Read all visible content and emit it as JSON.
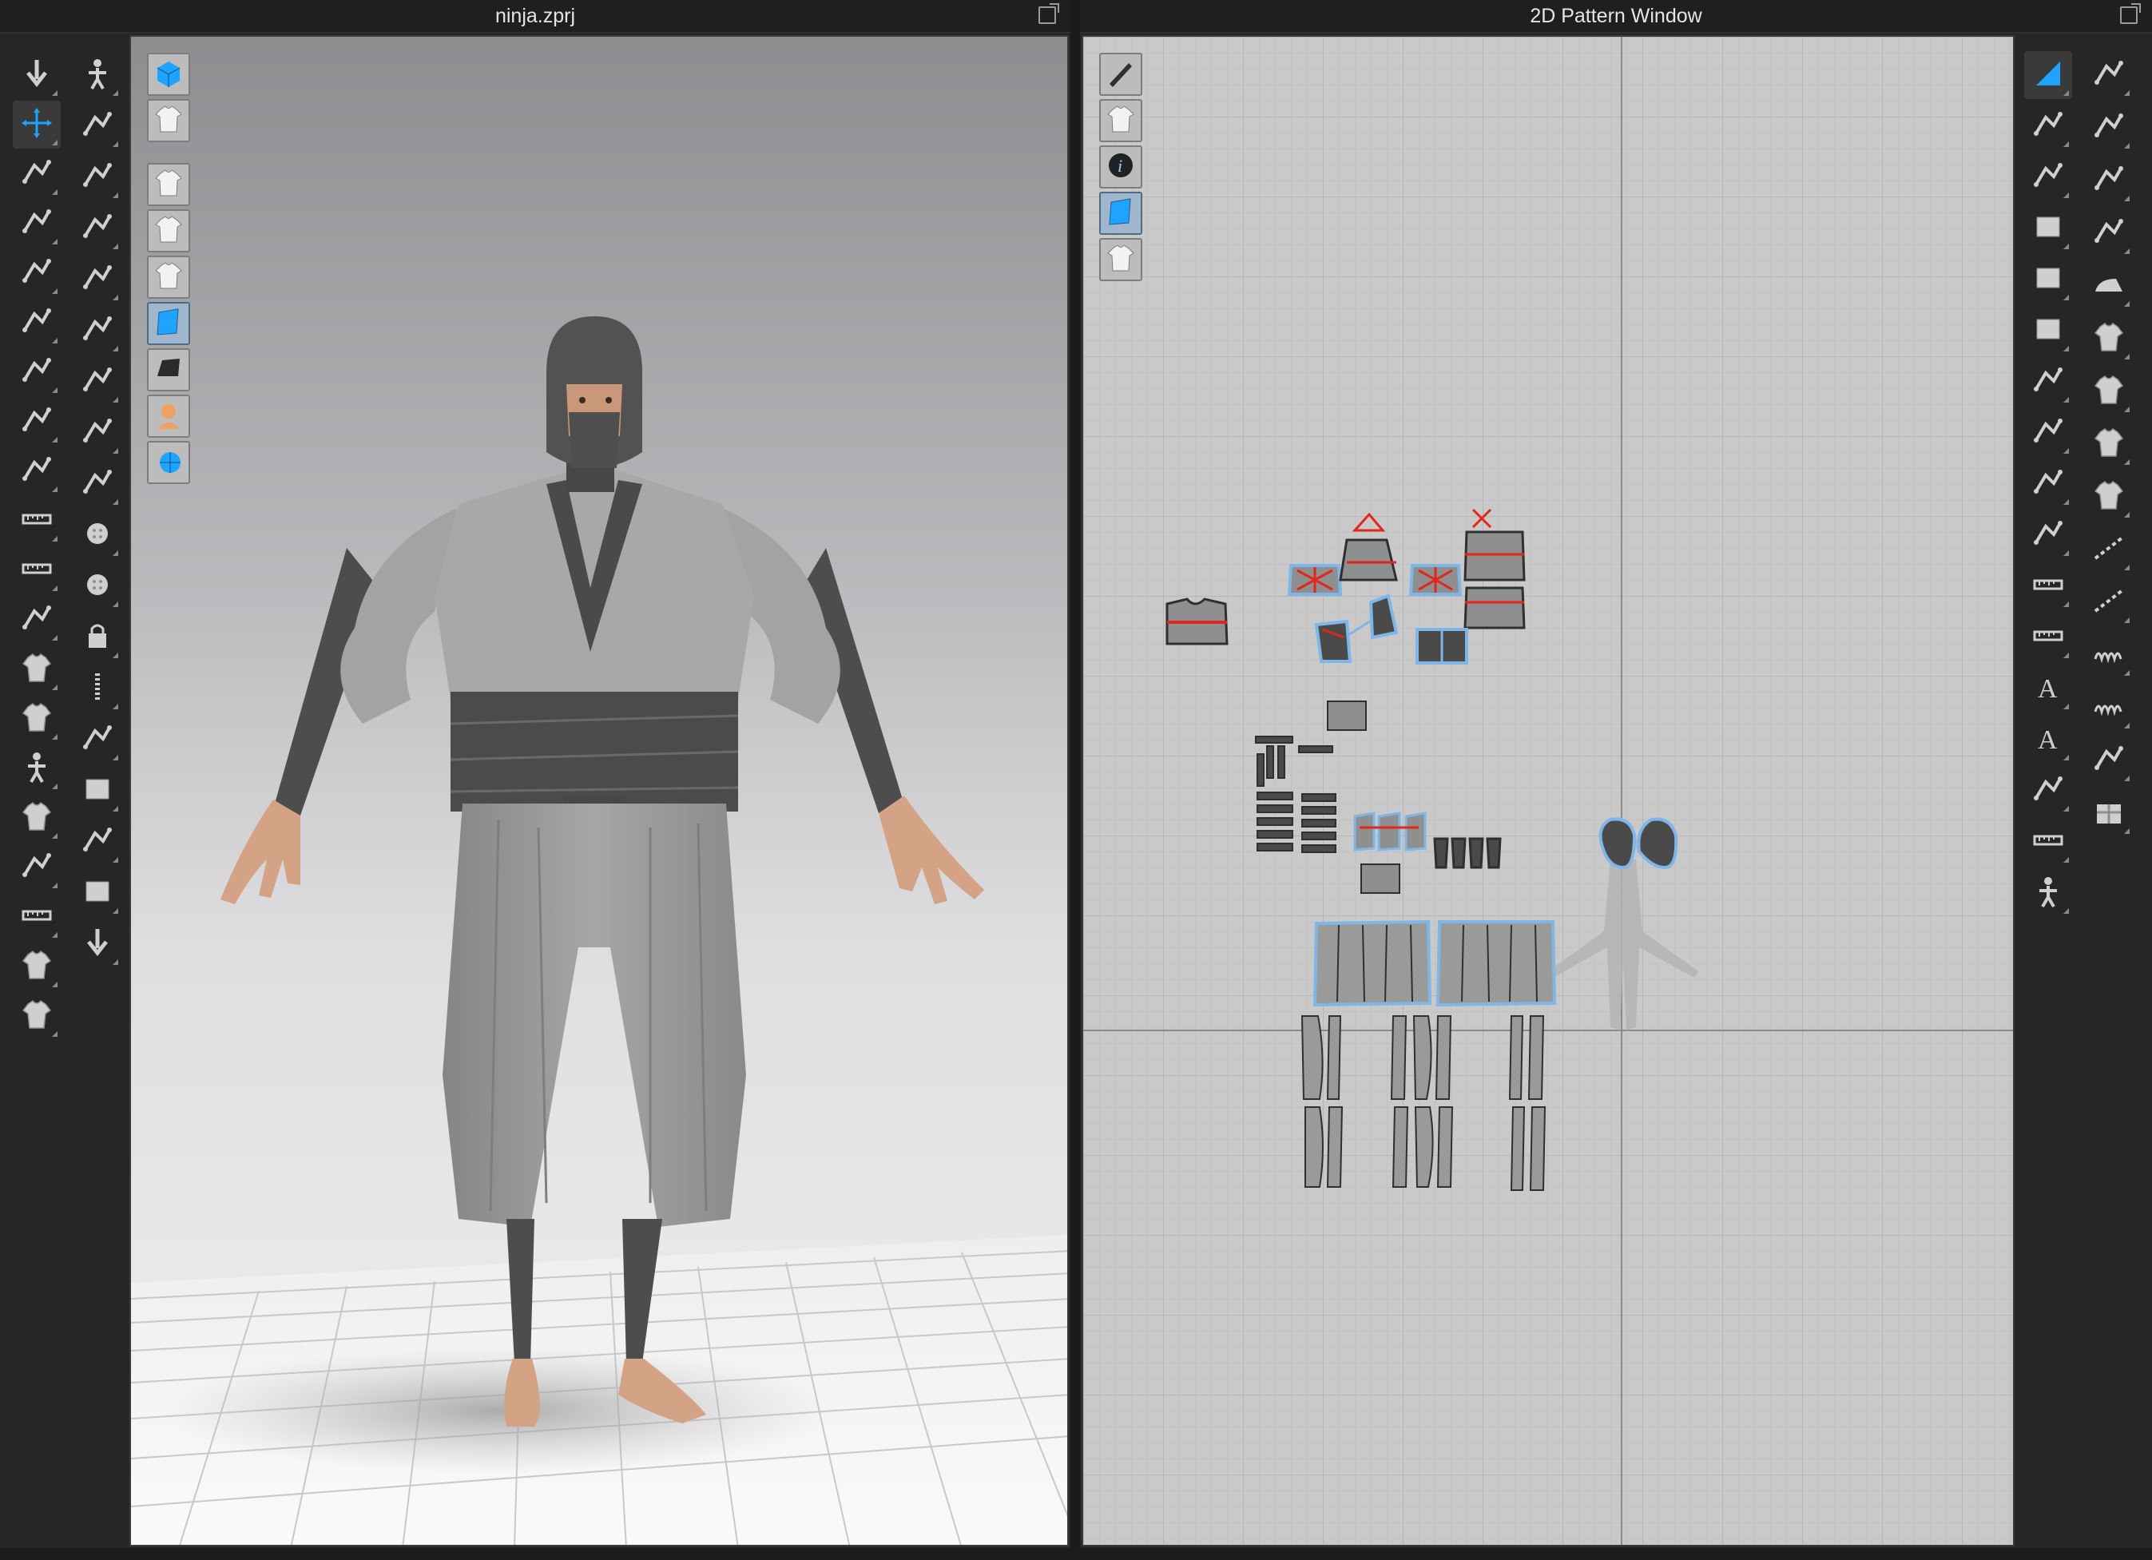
{
  "window3d": {
    "title": "ninja.zprj"
  },
  "window2d": {
    "title": "2D Pattern Window"
  },
  "colors": {
    "accent": "#1ea4ff",
    "seam_red": "#e3261b",
    "pattern_fill": "#8f8f8f",
    "pattern_dark": "#4b4b4b",
    "selection_outline": "#7fb6e8",
    "garment_gray": "#9a9a9a",
    "garment_dark": "#4a4a4a"
  },
  "toolbar3d_left": [
    {
      "icon": "simulation-icon"
    },
    {
      "icon": "select-move-icon",
      "active": true
    },
    {
      "icon": "select-mesh-icon"
    },
    {
      "icon": "fold-arrangement-icon"
    },
    {
      "icon": "transform-pattern-icon"
    },
    {
      "icon": "edit-curvature-icon"
    },
    {
      "icon": "fold-icon"
    },
    {
      "icon": "pin-icon"
    },
    {
      "icon": "tack-icon"
    },
    {
      "icon": "tape-icon"
    },
    {
      "icon": "avatar-measure-icon"
    },
    {
      "icon": "strengthen-icon"
    },
    {
      "icon": "shirt-garment-icon"
    },
    {
      "icon": "jacket-icon"
    },
    {
      "icon": "avatar-icon"
    },
    {
      "icon": "fitting-suit-icon"
    },
    {
      "icon": "puckering-icon"
    },
    {
      "icon": "ruler-icon"
    },
    {
      "icon": "shirt-select-icon"
    },
    {
      "icon": "shirt-front-icon"
    }
  ],
  "toolbar3d_right": [
    {
      "icon": "walk-pose-icon"
    },
    {
      "icon": "select-pattern-icon"
    },
    {
      "icon": "point-edit-icon"
    },
    {
      "icon": "brush-icon"
    },
    {
      "icon": "curve-point-icon"
    },
    {
      "icon": "segment-sew-icon"
    },
    {
      "icon": "free-sew-icon"
    },
    {
      "icon": "show-seam-icon"
    },
    {
      "icon": "texture-icon"
    },
    {
      "icon": "button-icon"
    },
    {
      "icon": "buttonhole-icon"
    },
    {
      "icon": "lock-icon"
    },
    {
      "icon": "zipper-icon"
    },
    {
      "icon": "piping-icon"
    },
    {
      "icon": "fabric-block-icon"
    },
    {
      "icon": "graphic-icon"
    },
    {
      "icon": "gradient-icon"
    },
    {
      "icon": "move-arrows-icon"
    }
  ],
  "viewport3d_tools": [
    {
      "icon": "background-cube-icon"
    },
    {
      "icon": "garment-display-icon"
    },
    {
      "icon": "shirt-show-icon"
    },
    {
      "icon": "eye-texture-icon"
    },
    {
      "icon": "avatar-eye-icon"
    },
    {
      "icon": "fabric-blue-icon",
      "selected": true
    },
    {
      "icon": "surface-dark-icon"
    },
    {
      "icon": "avatar-head-icon"
    },
    {
      "icon": "globe-eye-icon"
    }
  ],
  "viewport2d_tools": [
    {
      "icon": "pen-eye-icon"
    },
    {
      "icon": "shirt-eye-icon"
    },
    {
      "icon": "info-icon"
    },
    {
      "icon": "fabric-blue-icon",
      "selected": true
    },
    {
      "icon": "shirt-lock-icon"
    }
  ],
  "toolbar2d_left": [
    {
      "icon": "corner-edit-icon",
      "active": true
    },
    {
      "icon": "edit-point-icon"
    },
    {
      "icon": "edit-curvature-2d-icon"
    },
    {
      "icon": "polygon-icon"
    },
    {
      "icon": "rectangle-icon"
    },
    {
      "icon": "internal-rectangle-icon"
    },
    {
      "icon": "trace-icon"
    },
    {
      "icon": "cut-line-icon"
    },
    {
      "icon": "dart-icon"
    },
    {
      "icon": "fold-pattern-icon"
    },
    {
      "icon": "measure-length-icon"
    },
    {
      "icon": "tape-measure-icon"
    },
    {
      "icon": "text-a-icon"
    },
    {
      "icon": "text-a-alt-icon"
    },
    {
      "icon": "grid-lines-icon"
    },
    {
      "icon": "ruler-2d-icon"
    },
    {
      "icon": "avatar-small-icon"
    }
  ],
  "toolbar2d_right": [
    {
      "icon": "pattern-copy-icon"
    },
    {
      "icon": "segment-point-icon"
    },
    {
      "icon": "rotate-pattern-icon"
    },
    {
      "icon": "rotate-mesh-icon"
    },
    {
      "icon": "iron-icon"
    },
    {
      "icon": "shirt-point-icon"
    },
    {
      "icon": "shirt-hatch-icon"
    },
    {
      "icon": "shirt-checker-icon"
    },
    {
      "icon": "shirt-grid-icon"
    },
    {
      "icon": "dashed-line-icon"
    },
    {
      "icon": "dotted-line-icon"
    },
    {
      "icon": "spring-icon"
    },
    {
      "icon": "wave-stitch-icon"
    },
    {
      "icon": "add-graphic-icon"
    },
    {
      "icon": "gift-icon"
    }
  ]
}
